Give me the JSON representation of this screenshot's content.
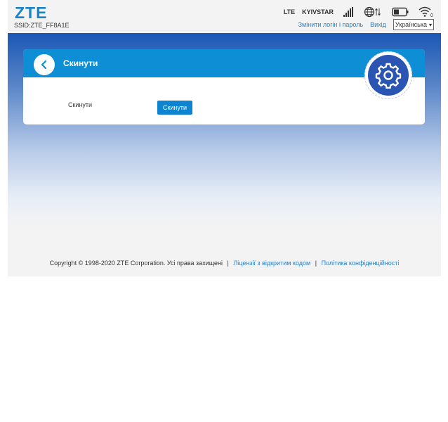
{
  "header": {
    "logo": "ZTE",
    "ssid": "SSID:ZTE_FF8A1E",
    "network_type": "LTE",
    "operator": "KYIVSTAR",
    "signal_bars": 5,
    "links": {
      "change_login": "Змінити логін і пароль",
      "logout": "Вихід"
    },
    "language": {
      "selected": "Українська"
    },
    "icons": [
      "signal-icon",
      "globe-data-icon",
      "battery-icon",
      "wifi-icon"
    ],
    "wifi_clients": "0"
  },
  "card": {
    "title": "Скинути",
    "row_label": "Скинути",
    "button_label": "Скинути"
  },
  "footer": {
    "copyright": "Copyright © 1998-2020 ZTE Corporation. Усі права захищені",
    "separator": "|",
    "license_link": "Ліцензії з відкритим кодом",
    "privacy_link": "Політика конфіденційності"
  },
  "colors": {
    "accent": "#0e8ed4",
    "link": "#2a7fc4",
    "gear_circle": "#2a55b2",
    "band_top": "#1b57b5"
  }
}
